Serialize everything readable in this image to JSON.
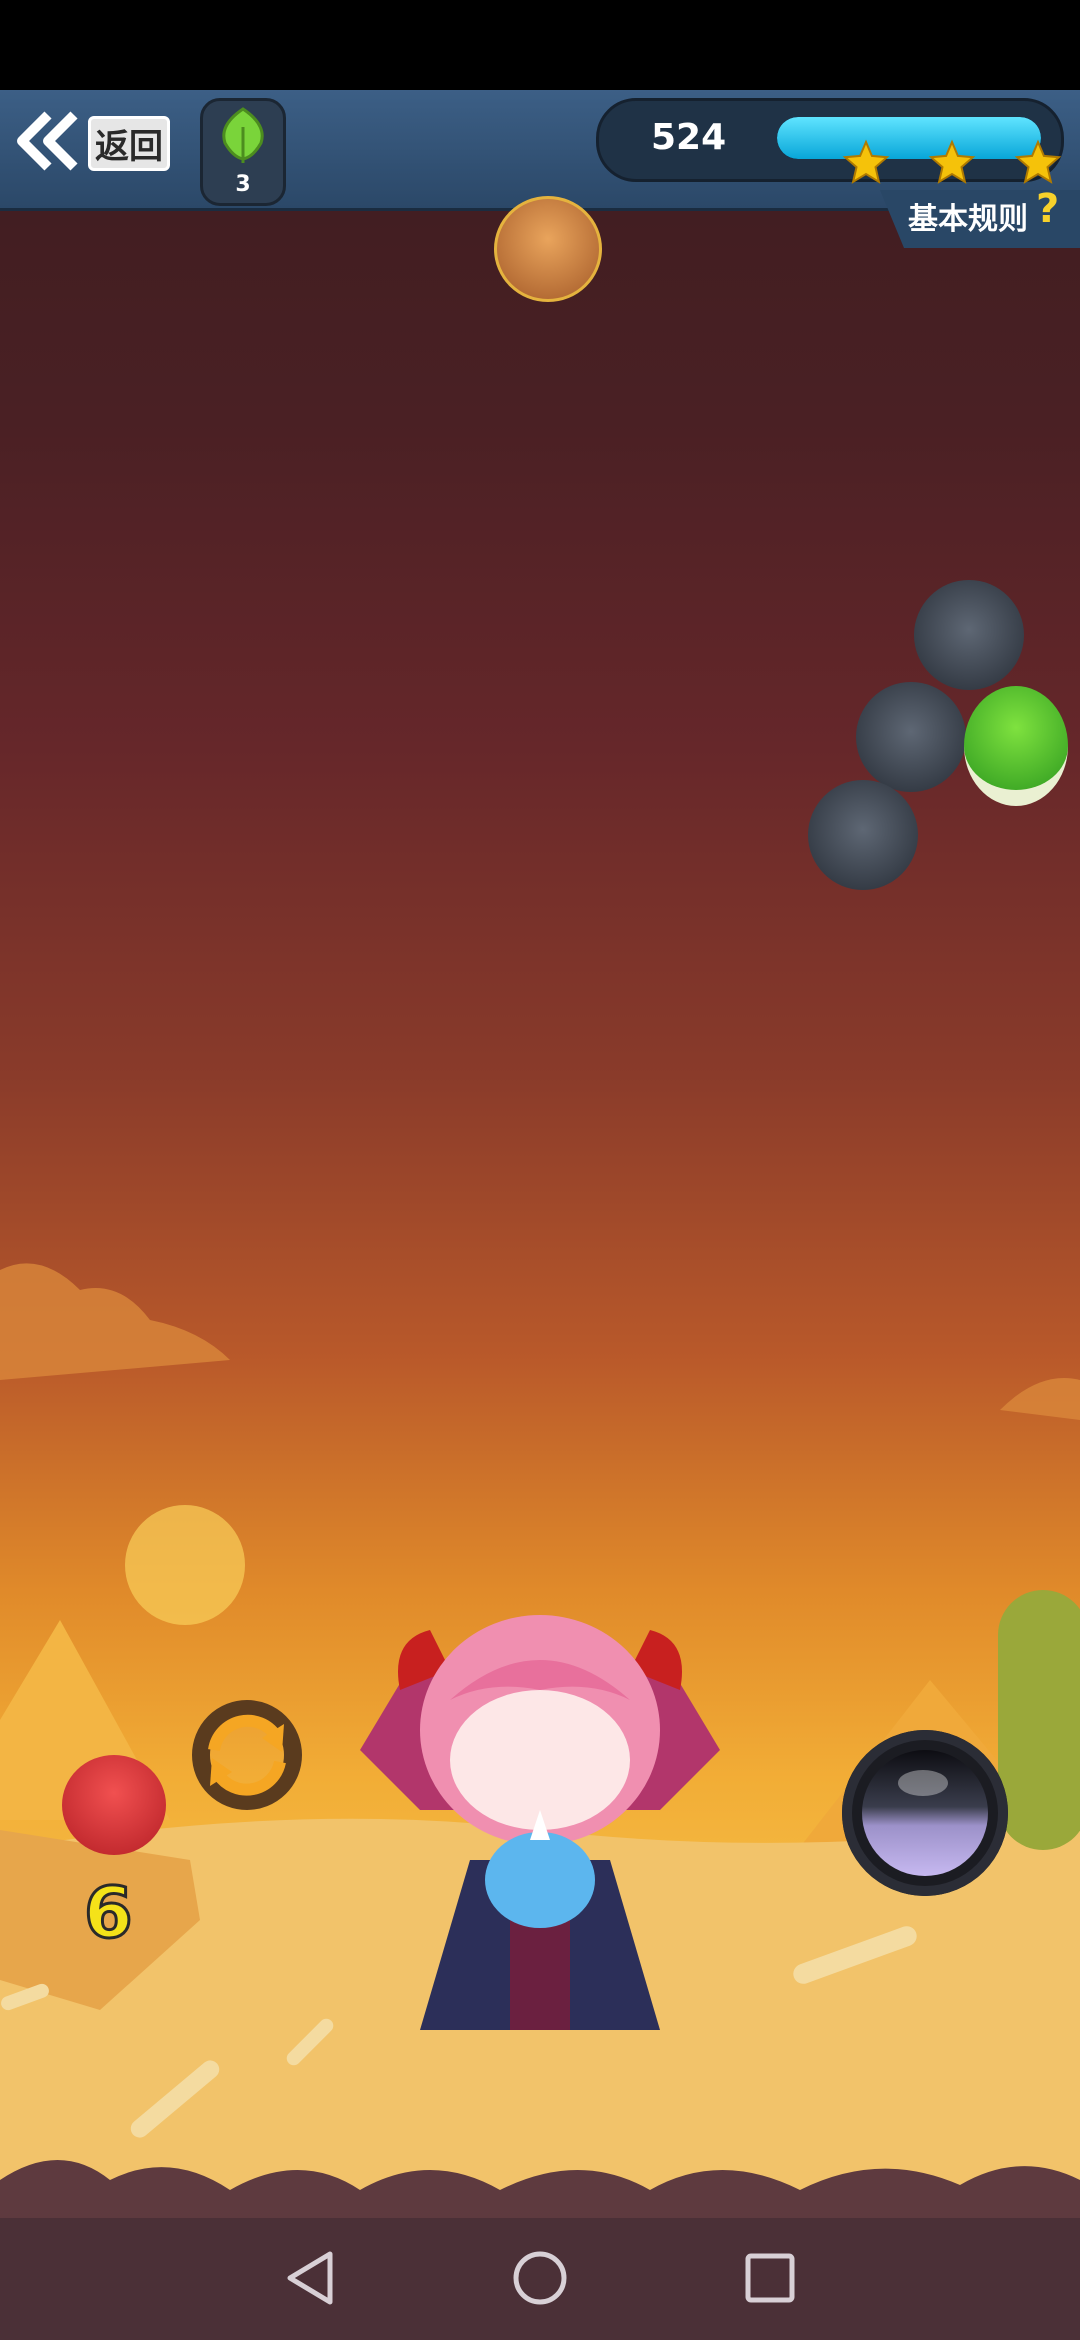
{
  "header": {
    "back_label": "返回",
    "leaf_count": "3",
    "score": "524",
    "progress_percent": 100,
    "stars": 3,
    "rules_label": "基本规则",
    "rules_help": "?"
  },
  "shooter": {
    "next_ball_count": "6"
  },
  "colors": {
    "topbar": "#2f4f73",
    "progress": "#1bbde8",
    "star": "#f5c20a",
    "count_text": "#f5e219"
  },
  "icons": {
    "back": "double-chevron-left-icon",
    "leaf": "leaf-icon",
    "swap": "swap-icon",
    "nav_back": "triangle-back-icon",
    "nav_home": "circle-home-icon",
    "nav_recent": "square-recent-icon"
  }
}
